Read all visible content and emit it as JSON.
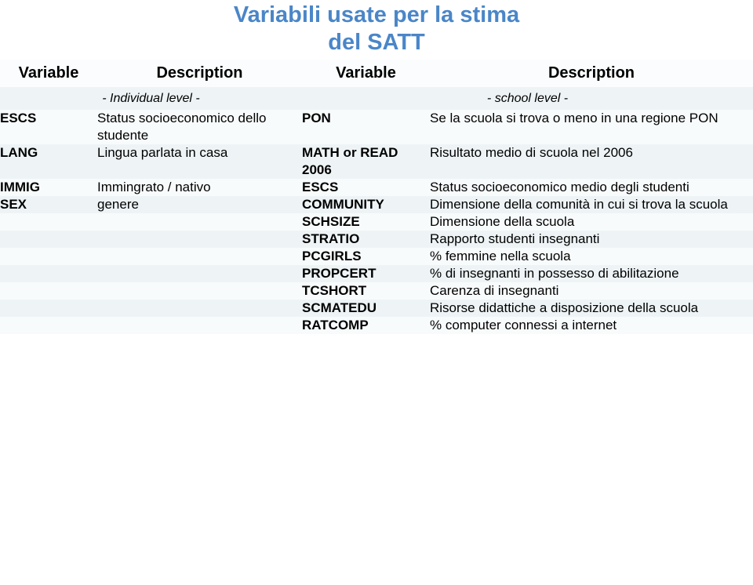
{
  "title": {
    "line1": "Variabili usate per la stima",
    "line2": "del SATT"
  },
  "colors": {
    "title": "#4a86c8",
    "row_light": "#f8fbfc",
    "row_dark": "#eef4f6",
    "grid_line": "#e3edf0",
    "text": "#000000"
  },
  "table": {
    "headers": {
      "variable_left": "Variable",
      "description_left": "Description",
      "variable_right": "Variable",
      "description_right": "Description"
    },
    "levels": {
      "left": "- Individual level -",
      "right": "- school level -"
    },
    "rows": [
      {
        "left_var": "ESCS",
        "left_desc": "Status socioeconomico dello studente",
        "right_var": "PON",
        "right_desc": "Se la scuola si trova o meno in una regione PON"
      },
      {
        "left_var": "LANG",
        "left_desc": "Lingua parlata in casa",
        "right_var": "MATH or READ 2006",
        "right_desc": "Risultato medio di scuola nel 2006"
      },
      {
        "left_var": "IMMIG",
        "left_desc": "Immingrato / nativo",
        "right_var": "ESCS",
        "right_desc": "Status socioeconomico medio degli studenti"
      },
      {
        "left_var": "SEX",
        "left_desc": "genere",
        "right_var": "COMMUNITY",
        "right_desc": "Dimensione della comunità in cui si trova la scuola"
      },
      {
        "left_var": "",
        "left_desc": "",
        "right_var": "SCHSIZE",
        "right_desc": "Dimensione della scuola"
      },
      {
        "left_var": "",
        "left_desc": "",
        "right_var": "STRATIO",
        "right_desc": "Rapporto studenti insegnanti"
      },
      {
        "left_var": "",
        "left_desc": "",
        "right_var": "PCGIRLS",
        "right_desc": "% femmine nella scuola"
      },
      {
        "left_var": "",
        "left_desc": "",
        "right_var": "PROPCERT",
        "right_desc": "% di insegnanti in possesso di abilitazione"
      },
      {
        "left_var": "",
        "left_desc": "",
        "right_var": "TCSHORT",
        "right_desc": "Carenza di insegnanti"
      },
      {
        "left_var": "",
        "left_desc": "",
        "right_var": "SCMATEDU",
        "right_desc": "Risorse didattiche a disposizione della scuola"
      },
      {
        "left_var": "",
        "left_desc": "",
        "right_var": "RATCOMP",
        "right_desc": "% computer connessi a internet"
      }
    ]
  }
}
